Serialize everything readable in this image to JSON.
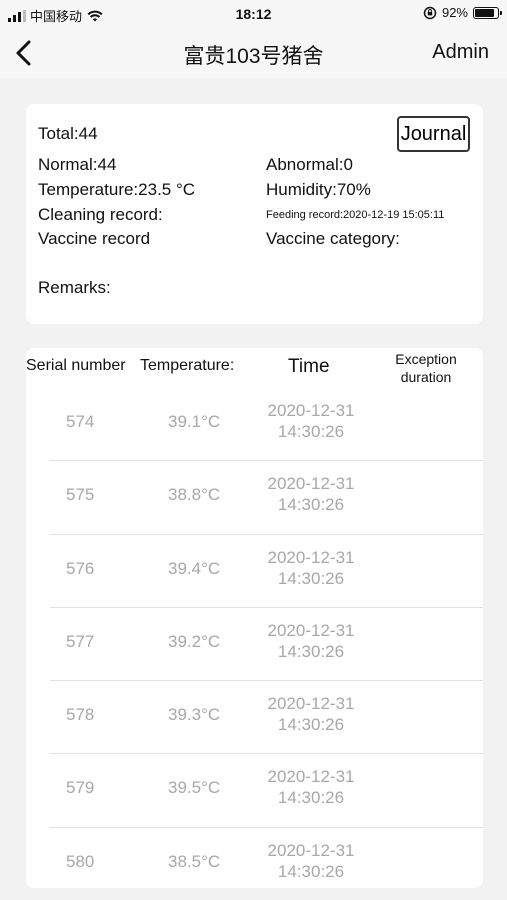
{
  "status_bar": {
    "carrier": "中国移动",
    "time": "18:12",
    "battery": "92%"
  },
  "nav": {
    "title": "富贵103号猪舍",
    "right_label": "Admin"
  },
  "info": {
    "total": "Total:44",
    "journal_label": "Journal",
    "normal": "Normal:44",
    "abnormal": "Abnormal:0",
    "temperature": "Temperature:23.5 °C",
    "humidity": "Humidity:70%",
    "cleaning": "Cleaning record:",
    "feeding": "Feeding record:2020-12-19 15:05:11",
    "vaccine_record": "Vaccine record",
    "vaccine_category": "Vaccine category:",
    "remarks": "Remarks:"
  },
  "table": {
    "headers": {
      "serial": "Serial number",
      "temperature": "Temperature:",
      "time": "Time",
      "exception_line1": "Exception",
      "exception_line2": "duration"
    },
    "rows": [
      {
        "serial": "574",
        "temp": "39.1°C",
        "date": "2020-12-31",
        "clock": "14:30:26"
      },
      {
        "serial": "575",
        "temp": "38.8°C",
        "date": "2020-12-31",
        "clock": "14:30:26"
      },
      {
        "serial": "576",
        "temp": "39.4°C",
        "date": "2020-12-31",
        "clock": "14:30:26"
      },
      {
        "serial": "577",
        "temp": "39.2°C",
        "date": "2020-12-31",
        "clock": "14:30:26"
      },
      {
        "serial": "578",
        "temp": "39.3°C",
        "date": "2020-12-31",
        "clock": "14:30:26"
      },
      {
        "serial": "579",
        "temp": "39.5°C",
        "date": "2020-12-31",
        "clock": "14:30:26"
      },
      {
        "serial": "580",
        "temp": "38.5°C",
        "date": "2020-12-31",
        "clock": "14:30:26"
      }
    ]
  },
  "icons": {
    "back": "chevron-left-icon",
    "signal": "cellular-signal-icon",
    "wifi": "wifi-icon",
    "rotation_lock": "rotation-lock-icon",
    "battery": "battery-icon"
  }
}
